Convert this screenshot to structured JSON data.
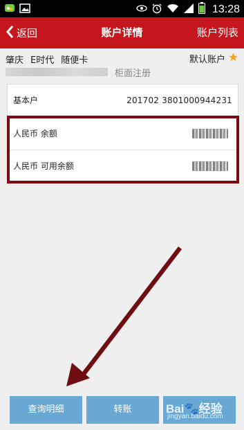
{
  "status_bar": {
    "time": "13:28",
    "icons": [
      "chat-icon",
      "image-icon",
      "eye-icon",
      "alarm-icon",
      "wifi-icon",
      "signal-icon",
      "battery-icon"
    ]
  },
  "header": {
    "back_label": "返回",
    "title": "账户详情",
    "list_label": "账户列表",
    "color": "#c4161c"
  },
  "account": {
    "tags": [
      "肇庆",
      "E时代",
      "随便卡"
    ],
    "default_label": "默认账户",
    "register_type": "柜面注册"
  },
  "basic": {
    "label": "基本户",
    "value": "201702 3801000944231"
  },
  "balances": [
    {
      "label": "人民币 余额"
    },
    {
      "label": "人民币 可用余额"
    }
  ],
  "buttons": {
    "detail": "查询明细",
    "transfer": "转账"
  },
  "watermark": {
    "main": "Bai🐾经验",
    "sub": "jingyan.baidu.com"
  },
  "colors": {
    "highlight_border": "#7c0a10",
    "button_bg": "#6aa8d4",
    "star": "#f5a623"
  }
}
